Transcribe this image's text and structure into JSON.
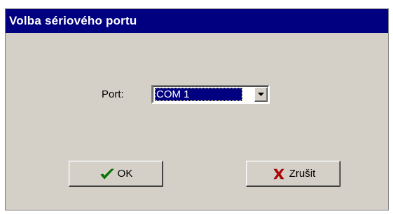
{
  "dialog": {
    "title": "Volba sériového portu",
    "title_bar_color": "#000080",
    "background_color": "#d4d0c8"
  },
  "port": {
    "label": "Port:",
    "selected_value": "COM 1"
  },
  "buttons": {
    "ok_label": "OK",
    "ok_icon": "checkmark-icon",
    "ok_icon_color": "#008000",
    "cancel_label": "Zrušit",
    "cancel_icon": "x-icon",
    "cancel_icon_color": "#c00000"
  }
}
